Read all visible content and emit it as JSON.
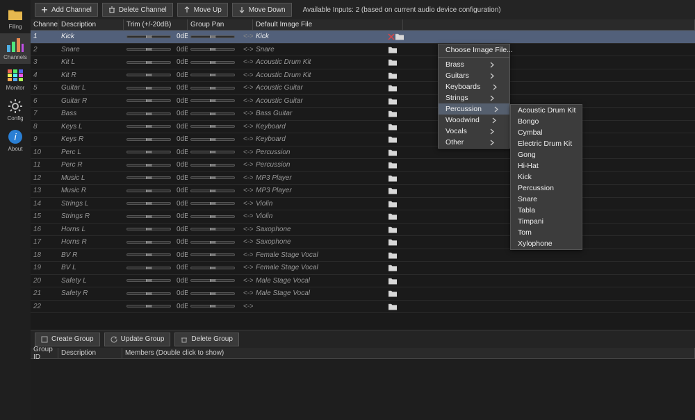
{
  "sidebar": [
    {
      "label": "Filing",
      "icon": "folder",
      "active": false
    },
    {
      "label": "Channels",
      "icon": "channels",
      "active": true
    },
    {
      "label": "Monitor",
      "icon": "grid",
      "active": false
    },
    {
      "label": "Config",
      "icon": "gear",
      "active": false
    },
    {
      "label": "About",
      "icon": "info",
      "active": false
    }
  ],
  "toolbar": {
    "add": "Add Channel",
    "delete": "Delete Channel",
    "up": "Move Up",
    "down": "Move Down",
    "status": "Available Inputs: 2 (based on current audio device configuration)"
  },
  "columns": {
    "channel": "Channel",
    "desc": "Description",
    "trim": "Trim (+/-20dB)",
    "group_pan": "Group Pan",
    "image": "Default Image File"
  },
  "rows": [
    {
      "ch": "1",
      "desc": "Kick",
      "trim": 50,
      "db": "0dB",
      "pan": 50,
      "img": "Kick",
      "selected": true,
      "showClose": true
    },
    {
      "ch": "2",
      "desc": "Snare",
      "trim": 50,
      "db": "0dB",
      "pan": 50,
      "img": "Snare",
      "selected": false
    },
    {
      "ch": "3",
      "desc": "Kit L",
      "trim": 50,
      "db": "0dB",
      "pan": 50,
      "img": "Acoustic Drum Kit",
      "selected": false
    },
    {
      "ch": "4",
      "desc": "Kit R",
      "trim": 50,
      "db": "0dB",
      "pan": 50,
      "img": "Acoustic Drum Kit",
      "selected": false
    },
    {
      "ch": "5",
      "desc": "Guitar L",
      "trim": 50,
      "db": "0dB",
      "pan": 50,
      "img": "Acoustic Guitar",
      "selected": false
    },
    {
      "ch": "6",
      "desc": "Guitar R",
      "trim": 50,
      "db": "0dB",
      "pan": 50,
      "img": "Acoustic Guitar",
      "selected": false
    },
    {
      "ch": "7",
      "desc": "Bass",
      "trim": 50,
      "db": "0dB",
      "pan": 50,
      "img": "Bass Guitar",
      "selected": false
    },
    {
      "ch": "8",
      "desc": "Keys L",
      "trim": 50,
      "db": "0dB",
      "pan": 50,
      "img": "Keyboard",
      "selected": false
    },
    {
      "ch": "9",
      "desc": "Keys R",
      "trim": 50,
      "db": "0dB",
      "pan": 50,
      "img": "Keyboard",
      "selected": false
    },
    {
      "ch": "10",
      "desc": "Perc L",
      "trim": 50,
      "db": "0dB",
      "pan": 50,
      "img": "Percussion",
      "selected": false
    },
    {
      "ch": "11",
      "desc": "Perc R",
      "trim": 50,
      "db": "0dB",
      "pan": 50,
      "img": "Percussion",
      "selected": false
    },
    {
      "ch": "12",
      "desc": "Music L",
      "trim": 50,
      "db": "0dB",
      "pan": 50,
      "img": "MP3 Player",
      "selected": false
    },
    {
      "ch": "13",
      "desc": "Music R",
      "trim": 50,
      "db": "0dB",
      "pan": 50,
      "img": "MP3 Player",
      "selected": false
    },
    {
      "ch": "14",
      "desc": "Strings L",
      "trim": 50,
      "db": "0dB",
      "pan": 50,
      "img": "Violin",
      "selected": false
    },
    {
      "ch": "15",
      "desc": "Strings R",
      "trim": 50,
      "db": "0dB",
      "pan": 50,
      "img": "Violin",
      "selected": false
    },
    {
      "ch": "16",
      "desc": "Horns L",
      "trim": 50,
      "db": "0dB",
      "pan": 50,
      "img": "Saxophone",
      "selected": false
    },
    {
      "ch": "17",
      "desc": "Horns R",
      "trim": 50,
      "db": "0dB",
      "pan": 50,
      "img": "Saxophone",
      "selected": false
    },
    {
      "ch": "18",
      "desc": "BV R",
      "trim": 50,
      "db": "0dB",
      "pan": 50,
      "img": "Female Stage Vocal",
      "selected": false
    },
    {
      "ch": "19",
      "desc": "BV L",
      "trim": 50,
      "db": "0dB",
      "pan": 50,
      "img": "Female Stage Vocal",
      "selected": false
    },
    {
      "ch": "20",
      "desc": "Safety L",
      "trim": 50,
      "db": "0dB",
      "pan": 50,
      "img": "Male Stage Vocal",
      "selected": false
    },
    {
      "ch": "21",
      "desc": "Safety R",
      "trim": 50,
      "db": "0dB",
      "pan": 50,
      "img": "Male Stage Vocal",
      "selected": false
    },
    {
      "ch": "22",
      "desc": "",
      "trim": 50,
      "db": "0dB",
      "pan": 50,
      "img": "",
      "selected": false
    }
  ],
  "group_bar": {
    "create": "Create Group",
    "update": "Update Group",
    "delete": "Delete Group"
  },
  "group_cols": {
    "id": "Group ID",
    "desc": "Description",
    "members": "Members (Double click to show)"
  },
  "context_menu": {
    "choose": "Choose Image File...",
    "categories": [
      {
        "label": "Brass"
      },
      {
        "label": "Guitars"
      },
      {
        "label": "Keyboards"
      },
      {
        "label": "Strings"
      },
      {
        "label": "Percussion",
        "highlight": true
      },
      {
        "label": "Woodwind"
      },
      {
        "label": "Vocals"
      },
      {
        "label": "Other"
      }
    ],
    "submenu": [
      "Acoustic Drum Kit",
      "Bongo",
      "Cymbal",
      "Electric Drum Kit",
      "Gong",
      "Hi-Hat",
      "Kick",
      "Percussion",
      "Snare",
      "Tabla",
      "Timpani",
      "Tom",
      "Xylophone"
    ]
  }
}
